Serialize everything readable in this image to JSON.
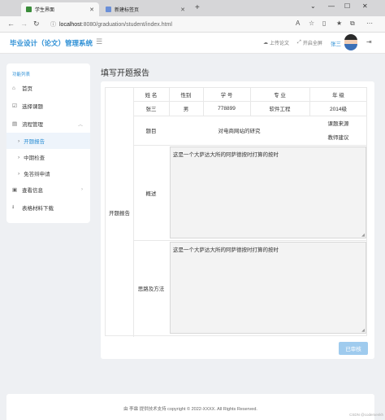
{
  "browser": {
    "tabs": [
      {
        "title": "学生界面",
        "active": true
      },
      {
        "title": "新建标签页",
        "active": false
      }
    ],
    "url_host": "localhost",
    "url_path": ":8080/graduation/student/index.html",
    "window_controls": [
      "⌄",
      "—",
      "☐",
      "✕"
    ]
  },
  "header": {
    "app_title": "毕业设计（论文）管理系统",
    "upload_label": "上传论文",
    "fullscreen_label": "开启全屏",
    "user_name": "张三"
  },
  "sidebar": {
    "title": "功能列表",
    "items": [
      {
        "label": "首页",
        "icon": "home-icon"
      },
      {
        "label": "选择课题",
        "icon": "checkbox-icon"
      },
      {
        "label": "流程管理",
        "icon": "workflow-icon"
      },
      {
        "label": "查看信息",
        "icon": "info-icon"
      },
      {
        "label": "表格材料下载",
        "icon": "download-icon"
      }
    ],
    "subitems": [
      {
        "label": "开题报告",
        "active": true
      },
      {
        "label": "中期检查",
        "active": false
      },
      {
        "label": "免答辩申请",
        "active": false
      }
    ]
  },
  "page": {
    "heading": "填写开题报告",
    "row_label": "开题报告",
    "columns": [
      "姓 名",
      "性别",
      "学 号",
      "专 业",
      "年 级"
    ],
    "values": [
      "张三",
      "男",
      "778899",
      "软件工程",
      "2014级"
    ],
    "topic_label": "题目",
    "topic_value": "对电商网站的研究",
    "topic_source": "课题来源",
    "topic_suggest": "教师建议",
    "overview_label": "概述",
    "overview_text": "这是一个大萨达大所的阿萨德按时打算的按时",
    "approach_label": "思路及方法",
    "approach_text": "这是一个大萨达大所的阿萨德按时打算的按时",
    "submit_label": "已审核"
  },
  "footer": {
    "text": "由 李霖 提供技术支持    copyright © 2022-XXXX. All Rights Reserved."
  },
  "watermark": "CSDN @codersenkh"
}
